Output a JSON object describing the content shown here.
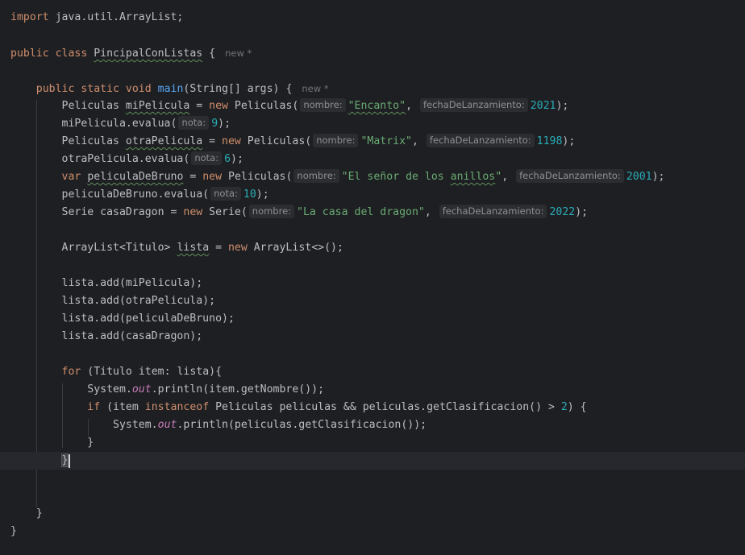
{
  "editor": {
    "background": "#1e1f22",
    "accent_colors": {
      "keyword": "#cf8e6d",
      "function": "#56a8f5",
      "string": "#6aab73",
      "number": "#2aacb8",
      "static_field": "#c77dbb"
    },
    "lines": [
      {
        "tokens": [
          {
            "t": "import",
            "c": "kw"
          },
          {
            "t": " java.util.ArrayList;"
          }
        ]
      },
      {
        "tokens": []
      },
      {
        "tokens": [
          {
            "t": "public class",
            "c": "kw"
          },
          {
            "t": " "
          },
          {
            "t": "PincipalConListas",
            "c": "typo"
          },
          {
            "t": " {"
          }
        ],
        "author": "new *"
      },
      {
        "tokens": []
      },
      {
        "tokens": [
          {
            "t": "    "
          },
          {
            "t": "public static void",
            "c": "kw"
          },
          {
            "t": " "
          },
          {
            "t": "main",
            "c": "fn"
          },
          {
            "t": "(String[] args) {"
          }
        ],
        "author": "new *"
      },
      {
        "tokens": [
          {
            "t": "        Peliculas "
          },
          {
            "t": "miPelicula",
            "c": "typo"
          },
          {
            "t": " = "
          },
          {
            "t": "new",
            "c": "kw"
          },
          {
            "t": " Peliculas("
          },
          {
            "h": "nombre:"
          },
          {
            "t": "\"Encanto\"",
            "c": "str typo"
          },
          {
            "t": ", "
          },
          {
            "h": "fechaDeLanzamiento:"
          },
          {
            "t": "2021",
            "c": "num"
          },
          {
            "t": ");"
          }
        ]
      },
      {
        "tokens": [
          {
            "t": "        miPelicula.evalua("
          },
          {
            "h": "nota:"
          },
          {
            "t": "9",
            "c": "num"
          },
          {
            "t": ");"
          }
        ]
      },
      {
        "tokens": [
          {
            "t": "        Peliculas "
          },
          {
            "t": "otraPelicula",
            "c": "typo"
          },
          {
            "t": " = "
          },
          {
            "t": "new",
            "c": "kw"
          },
          {
            "t": " Peliculas("
          },
          {
            "h": "nombre:"
          },
          {
            "t": "\"Matrix\"",
            "c": "str"
          },
          {
            "t": ", "
          },
          {
            "h": "fechaDeLanzamiento:"
          },
          {
            "t": "1198",
            "c": "num"
          },
          {
            "t": ");"
          }
        ]
      },
      {
        "tokens": [
          {
            "t": "        otraPelicula.evalua("
          },
          {
            "h": "nota:"
          },
          {
            "t": "6",
            "c": "num"
          },
          {
            "t": ");"
          }
        ]
      },
      {
        "tokens": [
          {
            "t": "        "
          },
          {
            "t": "var",
            "c": "kw"
          },
          {
            "t": " "
          },
          {
            "t": "peliculaDeBruno",
            "c": "typo"
          },
          {
            "t": " = "
          },
          {
            "t": "new",
            "c": "kw"
          },
          {
            "t": " Peliculas("
          },
          {
            "h": "nombre:"
          },
          {
            "t": "\"El señor de los ",
            "c": "str"
          },
          {
            "t": "anillos",
            "c": "str typo"
          },
          {
            "t": "\"",
            "c": "str"
          },
          {
            "t": ", "
          },
          {
            "h": "fechaDeLanzamiento:"
          },
          {
            "t": "2001",
            "c": "num"
          },
          {
            "t": ");"
          }
        ]
      },
      {
        "tokens": [
          {
            "t": "        peliculaDeBruno.evalua("
          },
          {
            "h": "nota:"
          },
          {
            "t": "10",
            "c": "num"
          },
          {
            "t": ");"
          }
        ]
      },
      {
        "tokens": [
          {
            "t": "        Serie casaDragon = "
          },
          {
            "t": "new",
            "c": "kw"
          },
          {
            "t": " Serie("
          },
          {
            "h": "nombre:"
          },
          {
            "t": "\"La casa del dragon\"",
            "c": "str"
          },
          {
            "t": ", "
          },
          {
            "h": "fechaDeLanzamiento:"
          },
          {
            "t": "2022",
            "c": "num"
          },
          {
            "t": ");"
          }
        ]
      },
      {
        "tokens": []
      },
      {
        "tokens": [
          {
            "t": "        ArrayList<Titulo> "
          },
          {
            "t": "lista",
            "c": "typo"
          },
          {
            "t": " = "
          },
          {
            "t": "new",
            "c": "kw"
          },
          {
            "t": " ArrayList<>();"
          }
        ]
      },
      {
        "tokens": []
      },
      {
        "tokens": [
          {
            "t": "        lista.add(miPelicula);"
          }
        ]
      },
      {
        "tokens": [
          {
            "t": "        lista.add(otraPelicula);"
          }
        ]
      },
      {
        "tokens": [
          {
            "t": "        lista.add(peliculaDeBruno);"
          }
        ]
      },
      {
        "tokens": [
          {
            "t": "        lista.add(casaDragon);"
          }
        ]
      },
      {
        "tokens": []
      },
      {
        "tokens": [
          {
            "t": "        "
          },
          {
            "t": "for",
            "c": "kw"
          },
          {
            "t": " (Titulo item: lista){"
          }
        ]
      },
      {
        "tokens": [
          {
            "t": "            System."
          },
          {
            "t": "out",
            "c": "stat"
          },
          {
            "t": ".println(item.getNombre());"
          }
        ]
      },
      {
        "tokens": [
          {
            "t": "            "
          },
          {
            "t": "if",
            "c": "kw"
          },
          {
            "t": " (item "
          },
          {
            "t": "instanceof",
            "c": "kw"
          },
          {
            "t": " Peliculas peliculas && peliculas.getClasificacion() > "
          },
          {
            "t": "2",
            "c": "num"
          },
          {
            "t": ") {"
          }
        ]
      },
      {
        "tokens": [
          {
            "t": "                System."
          },
          {
            "t": "out",
            "c": "stat"
          },
          {
            "t": ".println(peliculas.getClasificacion());"
          }
        ]
      },
      {
        "tokens": [
          {
            "t": "            }"
          }
        ]
      },
      {
        "tokens": [
          {
            "t": "        "
          },
          {
            "t": "}",
            "c": "brace-match"
          }
        ],
        "current": true
      },
      {
        "tokens": []
      },
      {
        "tokens": []
      },
      {
        "tokens": [
          {
            "t": "    }"
          }
        ]
      },
      {
        "tokens": [
          {
            "t": "}"
          }
        ]
      }
    ]
  }
}
